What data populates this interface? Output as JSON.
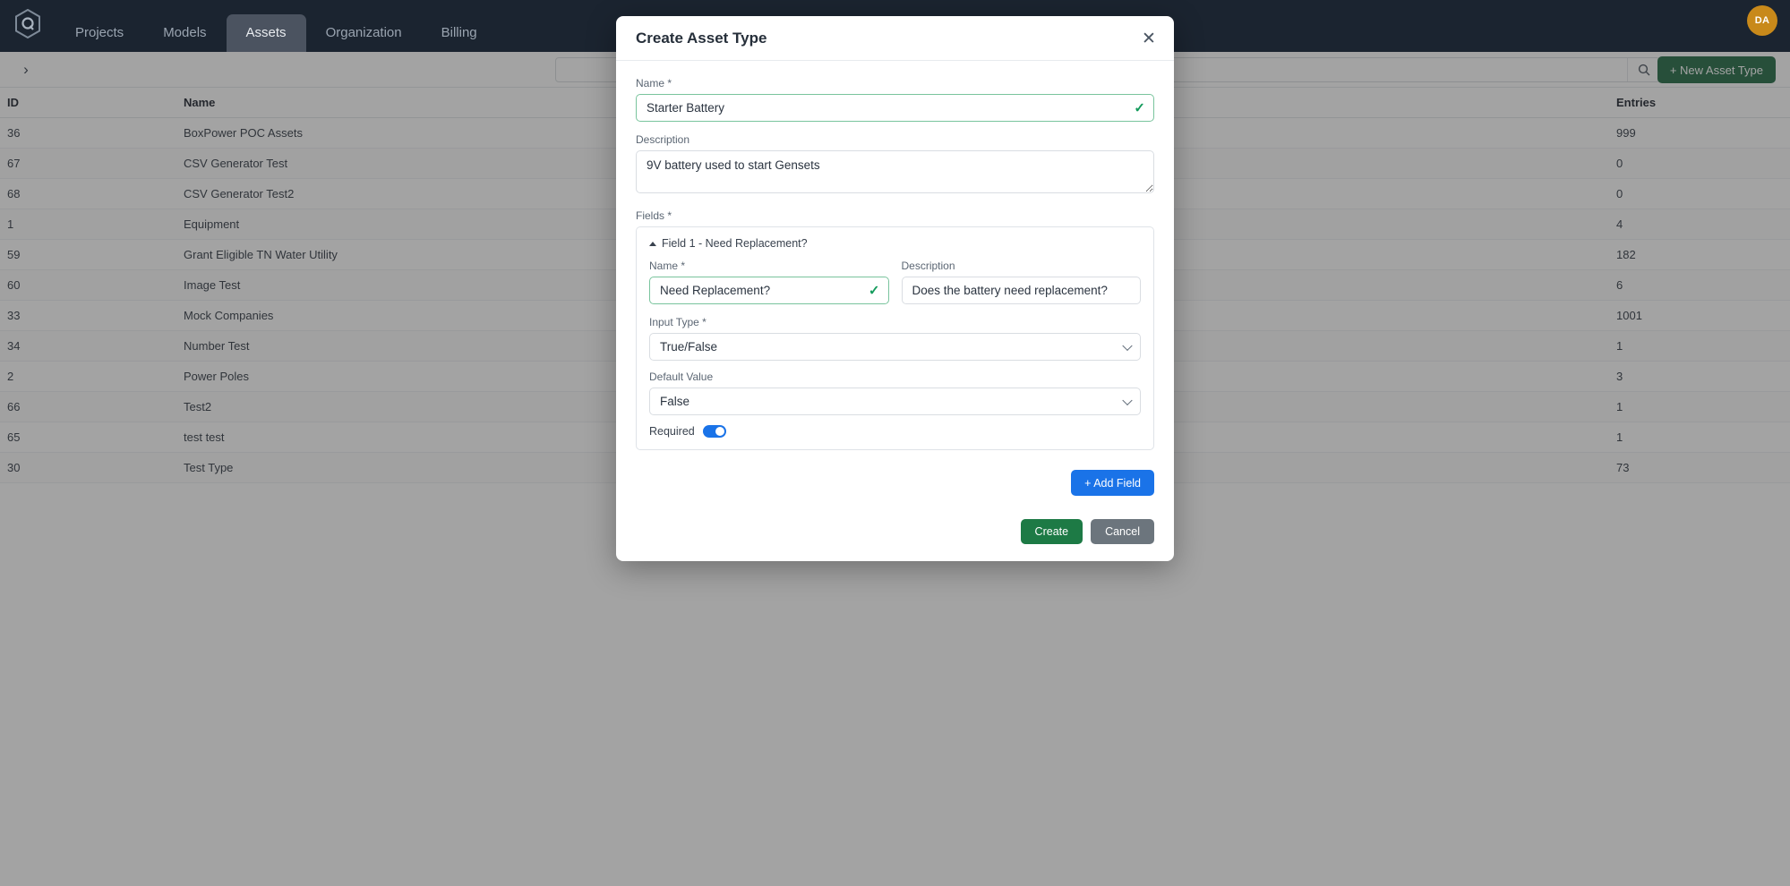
{
  "topnav": {
    "logo_icon": "hexagon-q-logo",
    "tabs": [
      {
        "label": "Projects",
        "active": false
      },
      {
        "label": "Models",
        "active": false
      },
      {
        "label": "Assets",
        "active": true
      },
      {
        "label": "Organization",
        "active": false
      },
      {
        "label": "Billing",
        "active": false
      }
    ],
    "avatar_initials": "DA",
    "avatar_color": "#c8891a"
  },
  "toolbar": {
    "expand_icon": "chevron-right-icon",
    "search_value": "",
    "search_placeholder": "",
    "search_icon": "search-icon",
    "new_asset_type_label": "+ New Asset Type",
    "new_asset_type_color": "#15603a"
  },
  "table": {
    "columns": [
      "ID",
      "Name",
      "Entries"
    ],
    "rows": [
      {
        "id": "36",
        "name": "BoxPower POC Assets",
        "entries": "999"
      },
      {
        "id": "67",
        "name": "CSV Generator Test",
        "entries": "0"
      },
      {
        "id": "68",
        "name": "CSV Generator Test2",
        "entries": "0"
      },
      {
        "id": "1",
        "name": "Equipment",
        "entries": "4"
      },
      {
        "id": "59",
        "name": "Grant Eligible TN Water Utility",
        "entries": "182"
      },
      {
        "id": "60",
        "name": "Image Test",
        "entries": "6"
      },
      {
        "id": "33",
        "name": "Mock Companies",
        "entries": "1001"
      },
      {
        "id": "34",
        "name": "Number Test",
        "entries": "1"
      },
      {
        "id": "2",
        "name": "Power Poles",
        "entries": "3"
      },
      {
        "id": "66",
        "name": "Test2",
        "entries": "1"
      },
      {
        "id": "65",
        "name": "test test",
        "entries": "1"
      },
      {
        "id": "30",
        "name": "Test Type",
        "entries": "73"
      }
    ]
  },
  "modal": {
    "title": "Create Asset Type",
    "close_icon": "close-icon",
    "name": {
      "label": "Name *",
      "value": "Starter Battery",
      "valid": true,
      "valid_icon": "check-icon",
      "valid_color": "#139b5b"
    },
    "description": {
      "label": "Description",
      "value": "9V battery used to start Gensets"
    },
    "fields_label": "Fields *",
    "fields": [
      {
        "header": "Field 1 - Need Replacement?",
        "collapse_icon": "caret-up-icon",
        "name": {
          "label": "Name *",
          "value": "Need Replacement?",
          "valid": true,
          "valid_icon": "check-icon"
        },
        "description": {
          "label": "Description",
          "value": "Does the battery need replacement?"
        },
        "input_type": {
          "label": "Input Type *",
          "value": "True/False",
          "chevron_icon": "chevron-down-icon"
        },
        "default_value": {
          "label": "Default Value",
          "value": "False",
          "chevron_icon": "chevron-down-icon"
        },
        "required": {
          "label": "Required",
          "on": true,
          "toggle_color": "#1a73e8"
        }
      }
    ],
    "add_field_label": "+ Add Field",
    "add_field_color": "#1a73e8",
    "create_label": "Create",
    "create_color": "#1d7a45",
    "cancel_label": "Cancel",
    "cancel_color": "#6c757d"
  }
}
